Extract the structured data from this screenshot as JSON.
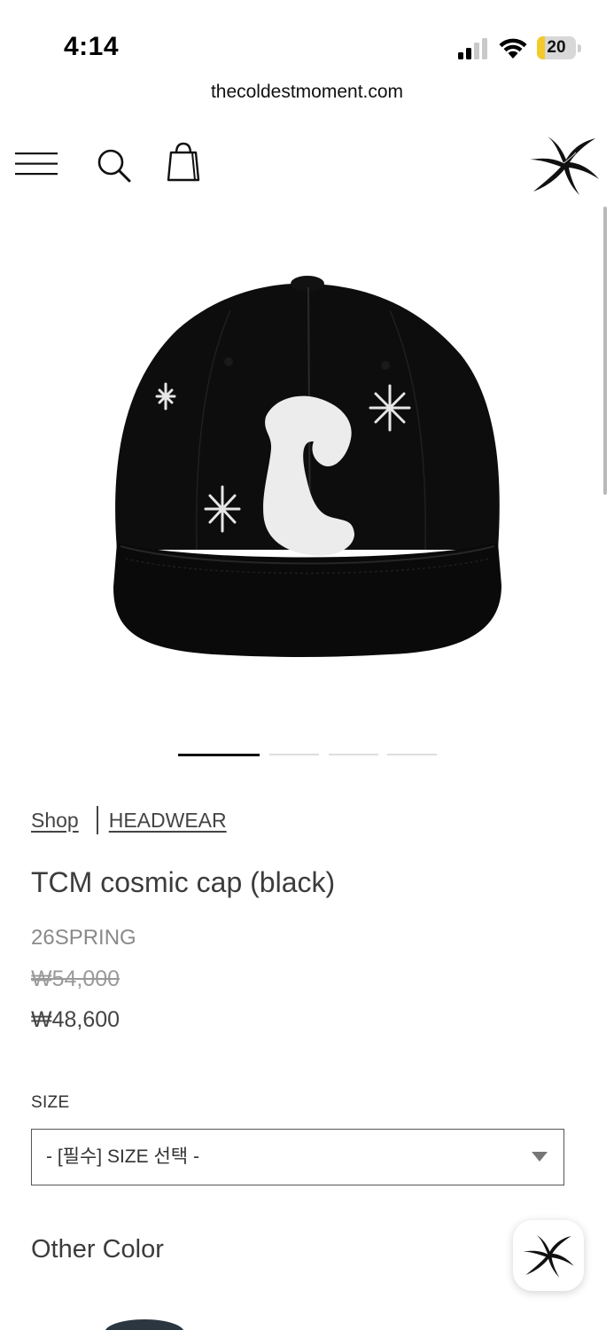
{
  "status_bar": {
    "time": "4:14",
    "battery": "20",
    "battery_level": 0.2
  },
  "browser": {
    "url": "thecoldestmoment.com"
  },
  "header": {
    "menu_icon": "hamburger-menu-icon",
    "search_icon": "search-icon",
    "cart_icon": "shopping-bag-icon",
    "logo_icon": "starfish-logo-icon"
  },
  "gallery": {
    "image_alt": "TCM cosmic cap (black)",
    "slide_count": 4,
    "active_slide": 1
  },
  "breadcrumb": {
    "shop": "Shop",
    "category": "HEADWEAR"
  },
  "product": {
    "title": "TCM cosmic cap (black)",
    "season": "26SPRING",
    "price_original": "₩54,000",
    "price_sale": "₩48,600"
  },
  "options": {
    "size_label": "SIZE",
    "size_selected": "- [필수] SIZE 선택 -"
  },
  "other_color": {
    "heading": "Other Color"
  },
  "colors": {
    "accent": "#111111",
    "battery": "#f4c92a",
    "muted_text": "#8a8a8a"
  }
}
